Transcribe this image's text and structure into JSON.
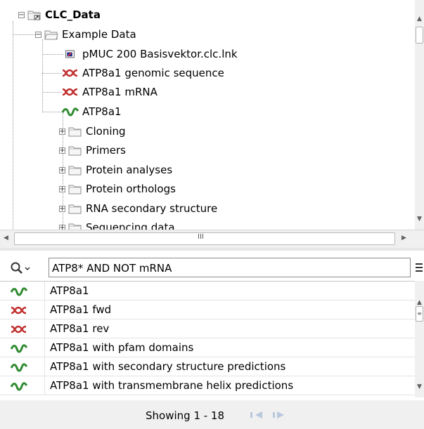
{
  "tree": {
    "root_label": "CLC_Data",
    "example_folder_label": "Example Data",
    "items": [
      {
        "label": "pMUC 200 Basisvektor.clc.lnk",
        "icon": "clc-link-icon"
      },
      {
        "label": "ATP8a1 genomic sequence",
        "icon": "dna-sequence-icon"
      },
      {
        "label": "ATP8a1 mRNA",
        "icon": "dna-sequence-icon"
      },
      {
        "label": "ATP8a1",
        "icon": "protein-sequence-icon"
      }
    ],
    "folders": [
      {
        "label": "Cloning"
      },
      {
        "label": "Primers"
      },
      {
        "label": "Protein analyses"
      },
      {
        "label": "Protein orthologs"
      },
      {
        "label": "RNA secondary structure"
      },
      {
        "label": "Sequencing data"
      }
    ],
    "scroll_grip": "III"
  },
  "search": {
    "value": "ATP8* AND NOT mRNA",
    "icon": "search-icon"
  },
  "results": [
    {
      "label": "ATP8a1",
      "icon": "protein-sequence-icon"
    },
    {
      "label": "ATP8a1 fwd",
      "icon": "dna-sequence-icon"
    },
    {
      "label": "ATP8a1 rev",
      "icon": "dna-sequence-icon"
    },
    {
      "label": "ATP8a1 with pfam domains",
      "icon": "protein-sequence-icon"
    },
    {
      "label": "ATP8a1 with secondary structure predictions",
      "icon": "protein-sequence-icon"
    },
    {
      "label": "ATP8a1 with transmembrane helix predictions",
      "icon": "protein-sequence-icon"
    }
  ],
  "footer": {
    "showing_text": "Showing 1 - 18"
  },
  "colors": {
    "dna": "#c0302f",
    "protein": "#2f8a2f",
    "folder_outline": "#9a9a9a"
  }
}
